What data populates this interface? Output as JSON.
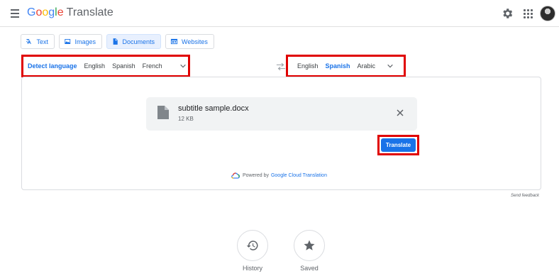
{
  "header": {
    "logo_letters": [
      "G",
      "o",
      "o",
      "g",
      "l",
      "e"
    ],
    "product": "Translate",
    "icons": [
      "menu-icon",
      "settings-icon",
      "apps-icon",
      "avatar"
    ]
  },
  "tabs": [
    {
      "label": "Text",
      "icon": "text-icon",
      "active": false
    },
    {
      "label": "Images",
      "icon": "image-icon",
      "active": false
    },
    {
      "label": "Documents",
      "icon": "document-icon",
      "active": true
    },
    {
      "label": "Websites",
      "icon": "website-icon",
      "active": false
    }
  ],
  "source_languages": {
    "items": [
      "Detect language",
      "English",
      "Spanish",
      "French"
    ],
    "selected": "Detect language"
  },
  "target_languages": {
    "items": [
      "English",
      "Spanish",
      "Arabic"
    ],
    "selected": "Spanish"
  },
  "file": {
    "name": "subtitle sample.docx",
    "size": "12 KB"
  },
  "translate_button": "Translate",
  "powered_by": {
    "prefix": "Powered by",
    "link": "Google Cloud Translation"
  },
  "feedback": "Send feedback",
  "bottom": {
    "history_label": "History",
    "saved_label": "Saved"
  },
  "colors": {
    "accent": "#1a73e8",
    "highlight_border": "#e00000"
  }
}
